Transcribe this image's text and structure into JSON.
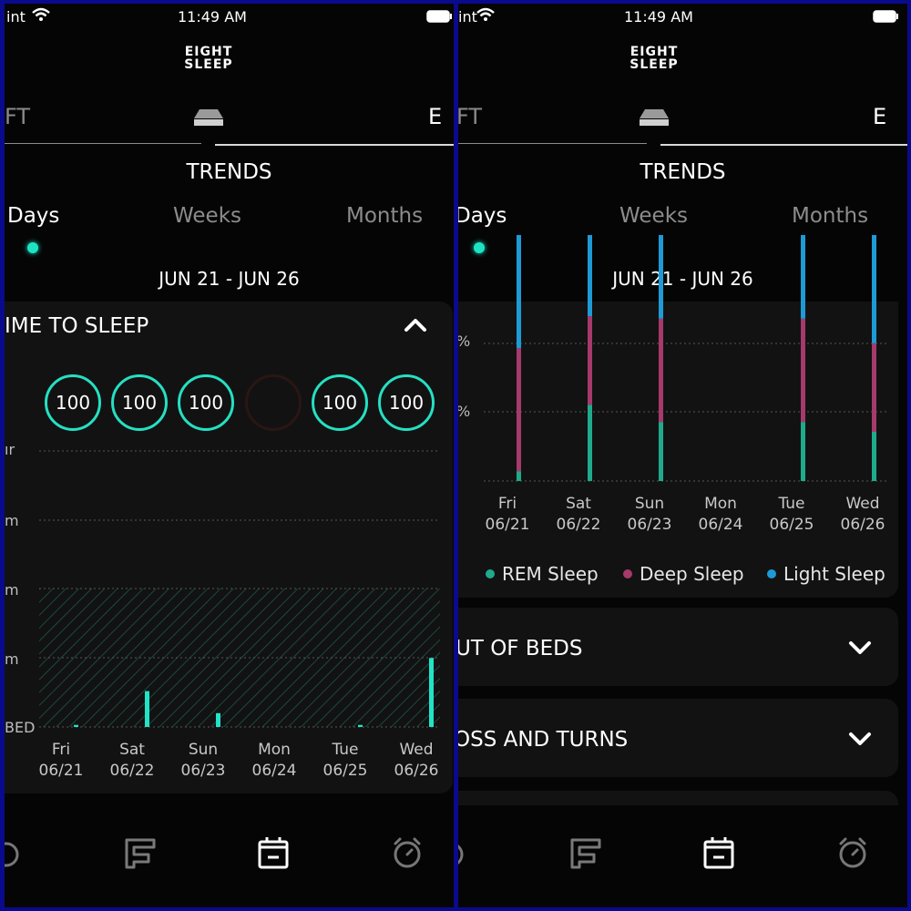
{
  "status": {
    "carrier": "int",
    "time": "11:49 AM"
  },
  "logo": "EIGHT SLEEP",
  "sides": {
    "left": "FT",
    "right": "E"
  },
  "title": "TRENDS",
  "periods": {
    "days": "Days",
    "weeks": "Weeks",
    "months": "Months"
  },
  "date_range": "JUN 21 - JUN 26",
  "left_card": {
    "title": "IME TO SLEEP",
    "scores": [
      "100",
      "100",
      "100",
      "",
      "100",
      "100"
    ],
    "y_labels": [
      "ır",
      "m",
      "m",
      "m",
      "BED"
    ],
    "days": [
      {
        "day": "Fri",
        "date": "06/21"
      },
      {
        "day": "Sat",
        "date": "06/22"
      },
      {
        "day": "Sun",
        "date": "06/23"
      },
      {
        "day": "Mon",
        "date": "06/24"
      },
      {
        "day": "Tue",
        "date": "06/25"
      },
      {
        "day": "Wed",
        "date": "06/26"
      }
    ]
  },
  "right_card": {
    "y_labels": [
      "%",
      "%"
    ],
    "days": [
      {
        "day": "Fri",
        "date": "06/21"
      },
      {
        "day": "Sat",
        "date": "06/22"
      },
      {
        "day": "Sun",
        "date": "06/23"
      },
      {
        "day": "Mon",
        "date": "06/24"
      },
      {
        "day": "Tue",
        "date": "06/25"
      },
      {
        "day": "Wed",
        "date": "06/26"
      }
    ],
    "legend": {
      "rem": "REM Sleep",
      "deep": "Deep Sleep",
      "light": "Light Sleep"
    },
    "colors": {
      "rem": "#1faa8c",
      "deep": "#a63a6a",
      "light": "#1e9ad6"
    }
  },
  "cards": {
    "out_of_beds": "UT OF BEDS",
    "toss_turns": "OSS AND TURNS"
  },
  "chart_data": [
    {
      "type": "bar",
      "categories": [
        "Fri 06/21",
        "Sat 06/22",
        "Sun 06/23",
        "Mon 06/24",
        "Tue 06/25",
        "Wed 06/26"
      ],
      "values": [
        0.3,
        5.2,
        2.0,
        0,
        0.3,
        10
      ],
      "ylabel": "",
      "ylim": [
        0,
        40
      ]
    },
    {
      "type": "bar",
      "categories": [
        "Fri 06/21",
        "Sat 06/22",
        "Sun 06/23",
        "Mon 06/24",
        "Tue 06/25",
        "Wed 06/26"
      ],
      "series": [
        {
          "name": "REM Sleep",
          "values": [
            4,
            31,
            24,
            0,
            24,
            20
          ]
        },
        {
          "name": "Deep Sleep",
          "values": [
            50,
            36,
            42,
            0,
            42,
            36
          ]
        },
        {
          "name": "Light Sleep",
          "values": [
            46,
            33,
            34,
            0,
            34,
            44
          ]
        }
      ],
      "stacked": true
    }
  ]
}
